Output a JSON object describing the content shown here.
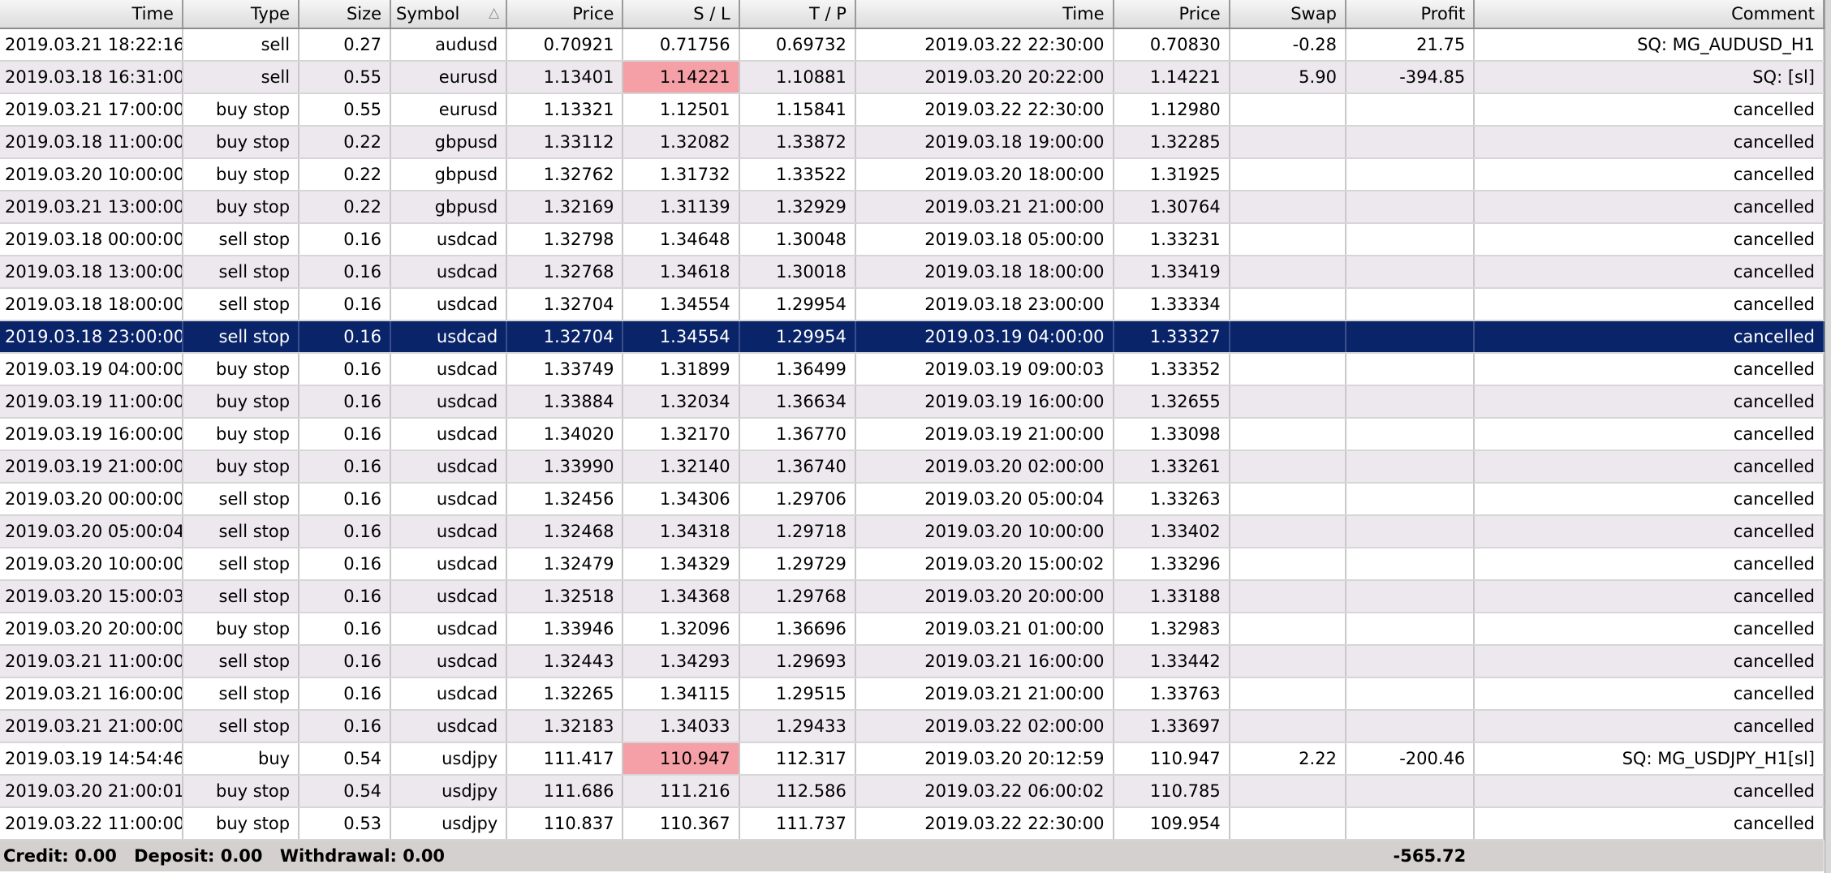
{
  "columns": [
    {
      "key": "open_time",
      "label": "Time"
    },
    {
      "key": "type",
      "label": "Type"
    },
    {
      "key": "size",
      "label": "Size"
    },
    {
      "key": "symbol",
      "label": "Symbol",
      "sort_indicator": "△"
    },
    {
      "key": "open_price",
      "label": "Price"
    },
    {
      "key": "sl",
      "label": "S / L"
    },
    {
      "key": "tp",
      "label": "T / P"
    },
    {
      "key": "close_time",
      "label": "Time"
    },
    {
      "key": "close_price",
      "label": "Price"
    },
    {
      "key": "swap",
      "label": "Swap"
    },
    {
      "key": "profit",
      "label": "Profit"
    },
    {
      "key": "comment",
      "label": "Comment"
    }
  ],
  "rows": [
    {
      "open_time": "2019.03.21 18:22:16",
      "type": "sell",
      "size": "0.27",
      "symbol": "audusd",
      "open_price": "0.70921",
      "sl": "0.71756",
      "tp": "0.69732",
      "close_time": "2019.03.22 22:30:00",
      "close_price": "0.70830",
      "swap": "-0.28",
      "profit": "21.75",
      "comment": "SQ: MG_AUDUSD_H1"
    },
    {
      "open_time": "2019.03.18 16:31:00",
      "type": "sell",
      "size": "0.55",
      "symbol": "eurusd",
      "open_price": "1.13401",
      "sl": "1.14221",
      "tp": "1.10881",
      "close_time": "2019.03.20 20:22:00",
      "close_price": "1.14221",
      "swap": "5.90",
      "profit": "-394.85",
      "comment": "SQ: [sl]",
      "sl_hit": true
    },
    {
      "open_time": "2019.03.21 17:00:00",
      "type": "buy stop",
      "size": "0.55",
      "symbol": "eurusd",
      "open_price": "1.13321",
      "sl": "1.12501",
      "tp": "1.15841",
      "close_time": "2019.03.22 22:30:00",
      "close_price": "1.12980",
      "swap": "",
      "profit": "",
      "comment": "cancelled"
    },
    {
      "open_time": "2019.03.18 11:00:00",
      "type": "buy stop",
      "size": "0.22",
      "symbol": "gbpusd",
      "open_price": "1.33112",
      "sl": "1.32082",
      "tp": "1.33872",
      "close_time": "2019.03.18 19:00:00",
      "close_price": "1.32285",
      "swap": "",
      "profit": "",
      "comment": "cancelled"
    },
    {
      "open_time": "2019.03.20 10:00:00",
      "type": "buy stop",
      "size": "0.22",
      "symbol": "gbpusd",
      "open_price": "1.32762",
      "sl": "1.31732",
      "tp": "1.33522",
      "close_time": "2019.03.20 18:00:00",
      "close_price": "1.31925",
      "swap": "",
      "profit": "",
      "comment": "cancelled"
    },
    {
      "open_time": "2019.03.21 13:00:00",
      "type": "buy stop",
      "size": "0.22",
      "symbol": "gbpusd",
      "open_price": "1.32169",
      "sl": "1.31139",
      "tp": "1.32929",
      "close_time": "2019.03.21 21:00:00",
      "close_price": "1.30764",
      "swap": "",
      "profit": "",
      "comment": "cancelled"
    },
    {
      "open_time": "2019.03.18 00:00:00",
      "type": "sell stop",
      "size": "0.16",
      "symbol": "usdcad",
      "open_price": "1.32798",
      "sl": "1.34648",
      "tp": "1.30048",
      "close_time": "2019.03.18 05:00:00",
      "close_price": "1.33231",
      "swap": "",
      "profit": "",
      "comment": "cancelled"
    },
    {
      "open_time": "2019.03.18 13:00:00",
      "type": "sell stop",
      "size": "0.16",
      "symbol": "usdcad",
      "open_price": "1.32768",
      "sl": "1.34618",
      "tp": "1.30018",
      "close_time": "2019.03.18 18:00:00",
      "close_price": "1.33419",
      "swap": "",
      "profit": "",
      "comment": "cancelled"
    },
    {
      "open_time": "2019.03.18 18:00:00",
      "type": "sell stop",
      "size": "0.16",
      "symbol": "usdcad",
      "open_price": "1.32704",
      "sl": "1.34554",
      "tp": "1.29954",
      "close_time": "2019.03.18 23:00:00",
      "close_price": "1.33334",
      "swap": "",
      "profit": "",
      "comment": "cancelled"
    },
    {
      "open_time": "2019.03.18 23:00:00",
      "type": "sell stop",
      "size": "0.16",
      "symbol": "usdcad",
      "open_price": "1.32704",
      "sl": "1.34554",
      "tp": "1.29954",
      "close_time": "2019.03.19 04:00:00",
      "close_price": "1.33327",
      "swap": "",
      "profit": "",
      "comment": "cancelled",
      "selected": true
    },
    {
      "open_time": "2019.03.19 04:00:00",
      "type": "buy stop",
      "size": "0.16",
      "symbol": "usdcad",
      "open_price": "1.33749",
      "sl": "1.31899",
      "tp": "1.36499",
      "close_time": "2019.03.19 09:00:03",
      "close_price": "1.33352",
      "swap": "",
      "profit": "",
      "comment": "cancelled"
    },
    {
      "open_time": "2019.03.19 11:00:00",
      "type": "buy stop",
      "size": "0.16",
      "symbol": "usdcad",
      "open_price": "1.33884",
      "sl": "1.32034",
      "tp": "1.36634",
      "close_time": "2019.03.19 16:00:00",
      "close_price": "1.32655",
      "swap": "",
      "profit": "",
      "comment": "cancelled"
    },
    {
      "open_time": "2019.03.19 16:00:00",
      "type": "buy stop",
      "size": "0.16",
      "symbol": "usdcad",
      "open_price": "1.34020",
      "sl": "1.32170",
      "tp": "1.36770",
      "close_time": "2019.03.19 21:00:00",
      "close_price": "1.33098",
      "swap": "",
      "profit": "",
      "comment": "cancelled"
    },
    {
      "open_time": "2019.03.19 21:00:00",
      "type": "buy stop",
      "size": "0.16",
      "symbol": "usdcad",
      "open_price": "1.33990",
      "sl": "1.32140",
      "tp": "1.36740",
      "close_time": "2019.03.20 02:00:00",
      "close_price": "1.33261",
      "swap": "",
      "profit": "",
      "comment": "cancelled"
    },
    {
      "open_time": "2019.03.20 00:00:00",
      "type": "sell stop",
      "size": "0.16",
      "symbol": "usdcad",
      "open_price": "1.32456",
      "sl": "1.34306",
      "tp": "1.29706",
      "close_time": "2019.03.20 05:00:04",
      "close_price": "1.33263",
      "swap": "",
      "profit": "",
      "comment": "cancelled"
    },
    {
      "open_time": "2019.03.20 05:00:04",
      "type": "sell stop",
      "size": "0.16",
      "symbol": "usdcad",
      "open_price": "1.32468",
      "sl": "1.34318",
      "tp": "1.29718",
      "close_time": "2019.03.20 10:00:00",
      "close_price": "1.33402",
      "swap": "",
      "profit": "",
      "comment": "cancelled"
    },
    {
      "open_time": "2019.03.20 10:00:00",
      "type": "sell stop",
      "size": "0.16",
      "symbol": "usdcad",
      "open_price": "1.32479",
      "sl": "1.34329",
      "tp": "1.29729",
      "close_time": "2019.03.20 15:00:02",
      "close_price": "1.33296",
      "swap": "",
      "profit": "",
      "comment": "cancelled"
    },
    {
      "open_time": "2019.03.20 15:00:03",
      "type": "sell stop",
      "size": "0.16",
      "symbol": "usdcad",
      "open_price": "1.32518",
      "sl": "1.34368",
      "tp": "1.29768",
      "close_time": "2019.03.20 20:00:00",
      "close_price": "1.33188",
      "swap": "",
      "profit": "",
      "comment": "cancelled"
    },
    {
      "open_time": "2019.03.20 20:00:00",
      "type": "buy stop",
      "size": "0.16",
      "symbol": "usdcad",
      "open_price": "1.33946",
      "sl": "1.32096",
      "tp": "1.36696",
      "close_time": "2019.03.21 01:00:00",
      "close_price": "1.32983",
      "swap": "",
      "profit": "",
      "comment": "cancelled"
    },
    {
      "open_time": "2019.03.21 11:00:00",
      "type": "sell stop",
      "size": "0.16",
      "symbol": "usdcad",
      "open_price": "1.32443",
      "sl": "1.34293",
      "tp": "1.29693",
      "close_time": "2019.03.21 16:00:00",
      "close_price": "1.33442",
      "swap": "",
      "profit": "",
      "comment": "cancelled"
    },
    {
      "open_time": "2019.03.21 16:00:00",
      "type": "sell stop",
      "size": "0.16",
      "symbol": "usdcad",
      "open_price": "1.32265",
      "sl": "1.34115",
      "tp": "1.29515",
      "close_time": "2019.03.21 21:00:00",
      "close_price": "1.33763",
      "swap": "",
      "profit": "",
      "comment": "cancelled"
    },
    {
      "open_time": "2019.03.21 21:00:00",
      "type": "sell stop",
      "size": "0.16",
      "symbol": "usdcad",
      "open_price": "1.32183",
      "sl": "1.34033",
      "tp": "1.29433",
      "close_time": "2019.03.22 02:00:00",
      "close_price": "1.33697",
      "swap": "",
      "profit": "",
      "comment": "cancelled"
    },
    {
      "open_time": "2019.03.19 14:54:46",
      "type": "buy",
      "size": "0.54",
      "symbol": "usdjpy",
      "open_price": "111.417",
      "sl": "110.947",
      "tp": "112.317",
      "close_time": "2019.03.20 20:12:59",
      "close_price": "110.947",
      "swap": "2.22",
      "profit": "-200.46",
      "comment": "SQ: MG_USDJPY_H1[sl]",
      "sl_hit": true
    },
    {
      "open_time": "2019.03.20 21:00:01",
      "type": "buy stop",
      "size": "0.54",
      "symbol": "usdjpy",
      "open_price": "111.686",
      "sl": "111.216",
      "tp": "112.586",
      "close_time": "2019.03.22 06:00:02",
      "close_price": "110.785",
      "swap": "",
      "profit": "",
      "comment": "cancelled"
    },
    {
      "open_time": "2019.03.22 11:00:00",
      "type": "buy stop",
      "size": "0.53",
      "symbol": "usdjpy",
      "open_price": "110.837",
      "sl": "110.367",
      "tp": "111.737",
      "close_time": "2019.03.22 22:30:00",
      "close_price": "109.954",
      "swap": "",
      "profit": "",
      "comment": "cancelled"
    }
  ],
  "summary": {
    "credit": "Credit: 0.00",
    "deposit": "Deposit: 0.00",
    "withdrawal": "Withdrawal: 0.00",
    "total_profit": "-565.72"
  },
  "colors": {
    "selected_row_bg": "#0a246a",
    "selected_row_text": "#ffffff",
    "alt_row_bg": "#ede8ee",
    "sl_hit_bg": "#f5a0a6",
    "summary_bg": "#d4d0d0"
  }
}
